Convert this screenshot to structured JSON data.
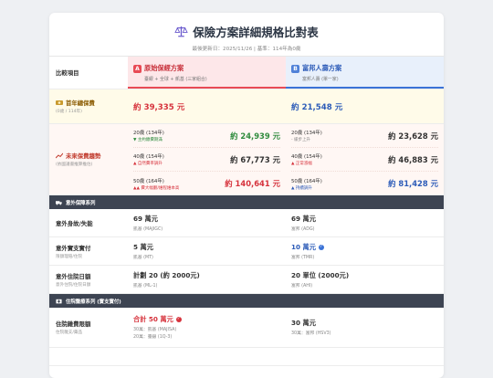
{
  "header": {
    "title": "保險方案詳細規格比對表",
    "subtitle": "最後更新日：2025/11/26 | 基準：114年為0歲"
  },
  "columns": {
    "item_label": "比較項目",
    "plan_a": {
      "tag": "A",
      "name": "原始保經方案",
      "desc": "臺銀 + 全球 + 凱基 (三家組合)"
    },
    "plan_b": {
      "tag": "B",
      "name": "富邦人壽方案",
      "desc": "富邦人壽 (單一家)"
    }
  },
  "premium": {
    "label": "首年總保費",
    "hint": "(0歲 / 114年)",
    "plan_a": "約 39,335 元",
    "plan_b": "約 21,548 元"
  },
  "trend": {
    "label": "未來保費趨勢",
    "hint": "(依國議書推算推估)",
    "plan_a": [
      {
        "age": "20歲 (134年)",
        "note": "▼ 主約繳費期滿",
        "value": "約 24,939 元"
      },
      {
        "age": "40歲 (154年)",
        "note": "▲ 自然費率調升",
        "value": "約 67,773 元"
      },
      {
        "age": "50歲 (164年)",
        "note": "▲▲ 費大幅翻/維程維本高",
        "value": "約 140,641 元"
      }
    ],
    "plan_b": [
      {
        "age": "20歲 (134年)",
        "note": "- 緩步上升",
        "value": "約 23,628 元"
      },
      {
        "age": "40歲 (154年)",
        "note": "▲ 正常漲幅",
        "value": "約 46,883 元"
      },
      {
        "age": "50歲 (164年)",
        "note": "▲ 持續調升",
        "value": "約 81,428 元"
      }
    ]
  },
  "section_accident": {
    "label": "意外保障系列"
  },
  "accident_items": [
    {
      "label": "意外身故/失能",
      "hint": "",
      "a_amt": "69 萬元",
      "a_src": "凱基 (MAJIGC)",
      "b_amt": "69 萬元",
      "b_src": "富邦 (ADG)"
    },
    {
      "label": "意外實支實付",
      "hint": "限額理賠/住院",
      "a_amt": "5 萬元",
      "a_src": "凱基 (MT)",
      "b_amt": "10 萬元",
      "b_src": "富邦 (TMR)"
    },
    {
      "label": "意外住院日額",
      "hint": "意外住院/住院日額",
      "a_amt": "計劃 20 (約 2000元)",
      "a_src": "凱基 (ML-1)",
      "b_amt": "20 單位 (2000元)",
      "b_src": "富邦 (AHI)"
    }
  ],
  "section_medical": {
    "label": "住院醫療系列 (實支實付)"
  },
  "medical": {
    "label": "住院雜費限額",
    "hint": "住院雜支/藥品",
    "a_amt": "合計 50 萬元",
    "a_src1": "30萬：凱基 (MAJISA)",
    "a_src2": "20萬：臺銀 (1Q-3)",
    "b_amt": "30 萬元",
    "b_src": "30萬：富邦 (HSV3)"
  }
}
